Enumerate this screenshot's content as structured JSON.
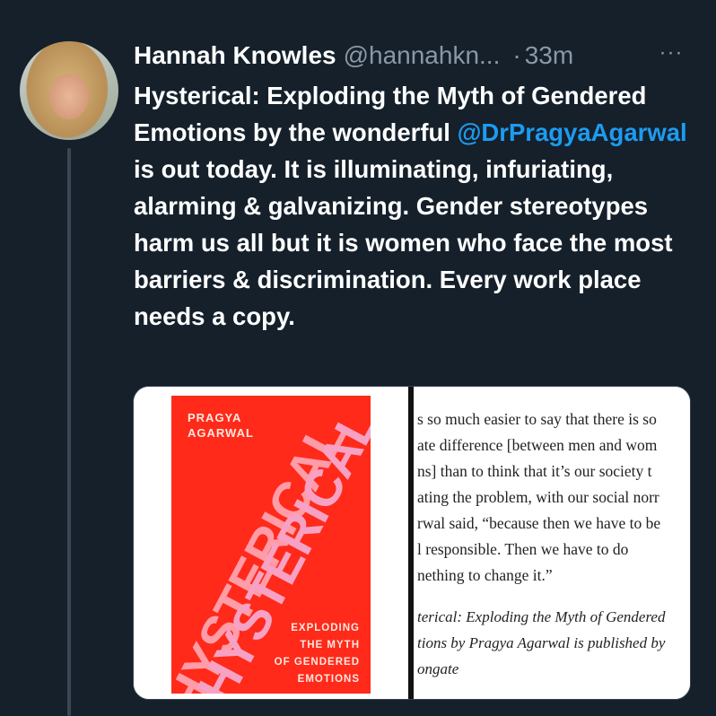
{
  "tweet": {
    "author_name": "Hannah Knowles",
    "handle": "@hannahkn...",
    "dot": "·",
    "time": "33m",
    "more": "···",
    "text_part1": "Hysterical: Exploding the Myth of Gendered Emotions by the wonderful ",
    "mention": "@DrPragyaAgarwal",
    "text_part2": " is out today. It is illuminating, infuriating, alarming & galvanizing. Gender stereotypes harm us all but it is women who face the most barriers & discrimination. Every work place needs a copy."
  },
  "book_cover": {
    "author_line1": "PRAGYA",
    "author_line2": "AGARWAL",
    "title": "HYSTERICAL",
    "subtitle_lines": [
      "EXPLODING",
      "THE MYTH",
      "OF GENDERED",
      "EMOTIONS"
    ]
  },
  "excerpt": {
    "lines": [
      "s so much easier to say that there is so",
      "ate difference [between men and wom",
      "ns] than to think that it’s our society t",
      "ating the problem, with our social norr",
      "rwal said, “because then we have to be",
      "l responsible. Then we have to do",
      "nething to change it.”"
    ],
    "caption_lines": [
      "terical: Exploding the Myth of Gendered",
      "tions by Pragya Agarwal is published by",
      "ongate"
    ]
  },
  "colors": {
    "background": "#15202b",
    "mention": "#1d9bf0",
    "muted": "#8b98a5",
    "cover_red": "#ff2a1a",
    "cover_pink": "#f7a2c4"
  }
}
